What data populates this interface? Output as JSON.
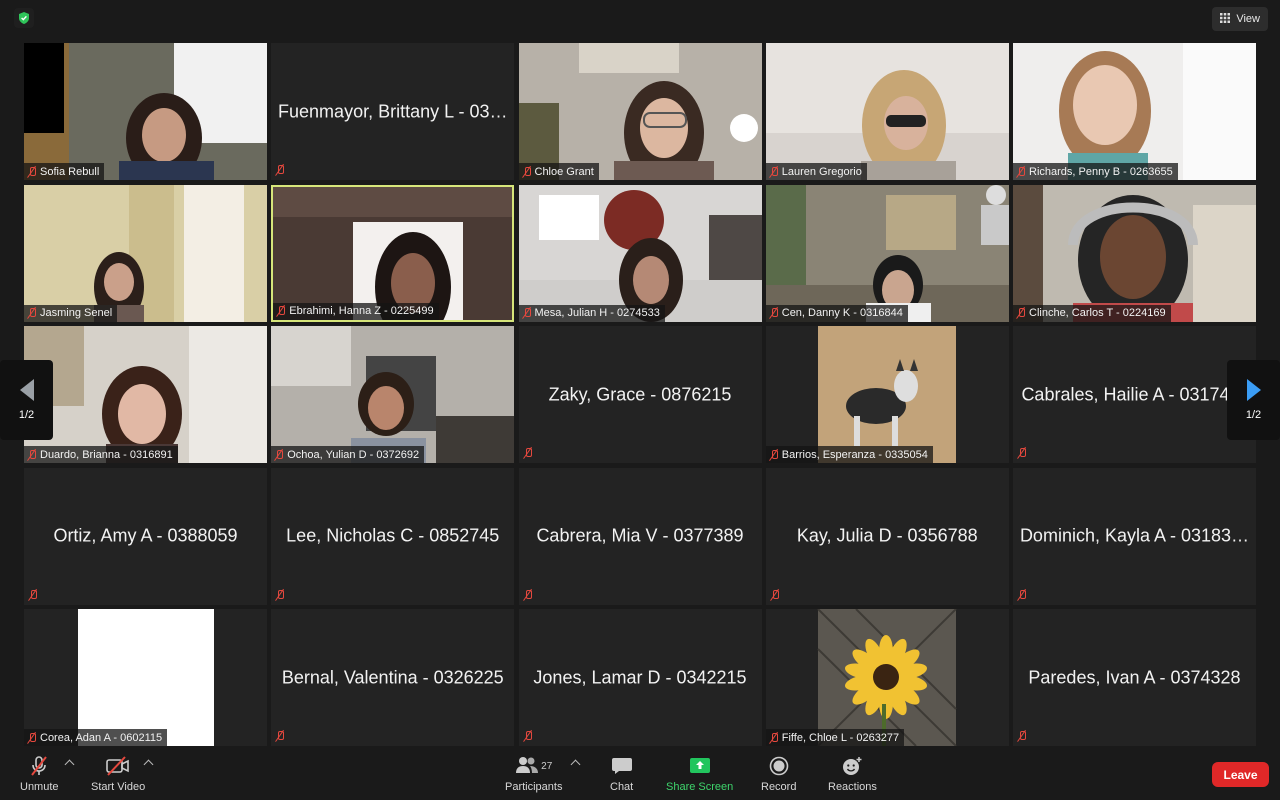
{
  "topbar": {
    "view_label": "View"
  },
  "pager": {
    "left": "1/2",
    "right": "1/2"
  },
  "tiles": [
    {
      "name": "Sofia Rebull",
      "video": "room-window"
    },
    {
      "name": "Fuenmayor, Brittany L - 03…",
      "video": null
    },
    {
      "name": "Chloe Grant",
      "video": "room-lamp"
    },
    {
      "name": "Lauren Gregorio",
      "video": "blonde"
    },
    {
      "name": "Richards, Penny B - 0263655",
      "video": "bright-room"
    },
    {
      "name": "Jasming Senel",
      "video": "beige-room"
    },
    {
      "name": "Ebrahimi, Hanna Z - 0225499",
      "video": "dim-room",
      "active": true
    },
    {
      "name": "Mesa, Julian H - 0274533",
      "video": "bedroom"
    },
    {
      "name": "Cen, Danny K - 0316844",
      "video": "cartoon-lab"
    },
    {
      "name": "Clinche, Carlos T - 0224169",
      "video": "headphones"
    },
    {
      "name": "Duardo, Brianna - 0316891",
      "video": "white-room"
    },
    {
      "name": "Ochoa, Yulian D - 0372692",
      "video": "grey-room"
    },
    {
      "name": "Zaky, Grace - 0876215",
      "video": null
    },
    {
      "name": "Barrios, Esperanza - 0335054",
      "video": "husky"
    },
    {
      "name": "Cabrales, Hailie A - 03174…",
      "video": null
    },
    {
      "name": "Ortiz, Amy A - 0388059",
      "video": null
    },
    {
      "name": "Lee, Nicholas C - 0852745",
      "video": null
    },
    {
      "name": "Cabrera, Mia V - 0377389",
      "video": null
    },
    {
      "name": "Kay, Julia D - 0356788",
      "video": null
    },
    {
      "name": "Dominich, Kayla A - 03183…",
      "video": null
    },
    {
      "name": "Corea, Adan A - 0602115",
      "video": "white-card"
    },
    {
      "name": "Bernal, Valentina - 0326225",
      "video": null
    },
    {
      "name": "Jones, Lamar D - 0342215",
      "video": null
    },
    {
      "name": "Fiffe, Chloe L - 0263277",
      "video": "sunflower"
    },
    {
      "name": "Paredes, Ivan A - 0374328",
      "video": null
    }
  ],
  "toolbar": {
    "unmute": "Unmute",
    "start_video": "Start Video",
    "participants": "Participants",
    "participants_count": "27",
    "chat": "Chat",
    "share_screen": "Share Screen",
    "record": "Record",
    "reactions": "Reactions",
    "leave": "Leave"
  },
  "colors": {
    "accent_green": "#22c55e",
    "leave_red": "#e02828",
    "active_speaker": "#d6e57a",
    "nav_arrow": "#3b9df5"
  }
}
